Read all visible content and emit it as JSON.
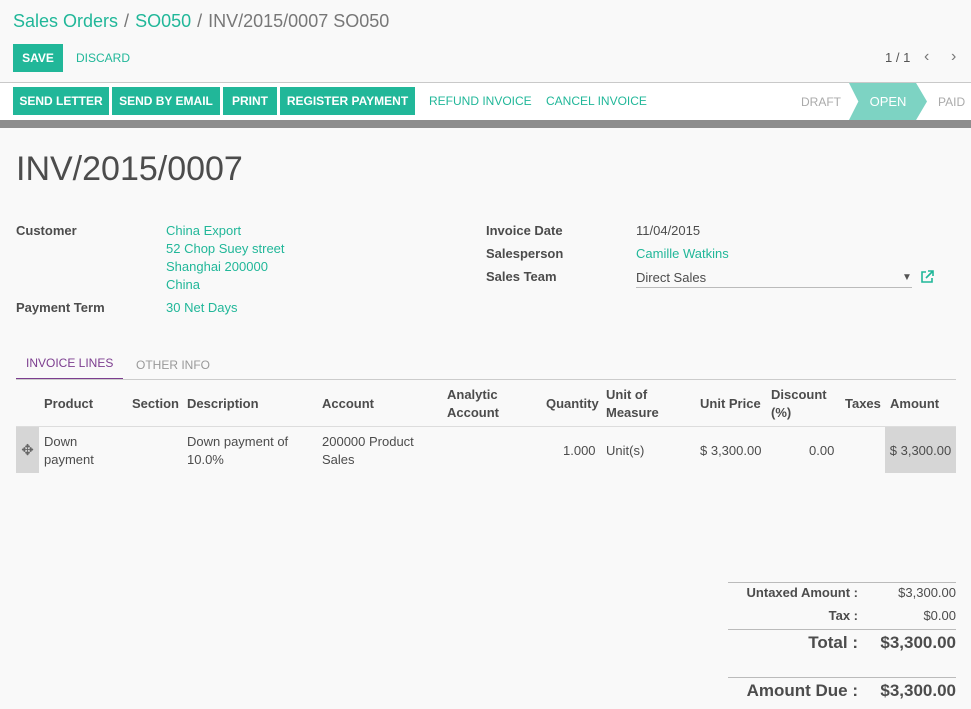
{
  "breadcrumb": {
    "root": "Sales Orders",
    "mid": "SO050",
    "current": "INV/2015/0007 SO050",
    "sep": "/"
  },
  "actions": {
    "save": "SAVE",
    "discard": "DISCARD"
  },
  "pager": {
    "value": "1 / 1",
    "prev": "‹",
    "next": "›"
  },
  "toolbar": {
    "send_letter": "SEND LETTER",
    "send_email": "SEND BY EMAIL",
    "print": "PRINT",
    "register_payment": "REGISTER PAYMENT",
    "refund": "REFUND INVOICE",
    "cancel": "CANCEL INVOICE"
  },
  "status": {
    "draft": "DRAFT",
    "open": "OPEN",
    "paid": "PAID",
    "active": "OPEN"
  },
  "invoice": {
    "title": "INV/2015/0007",
    "customer_label": "Customer",
    "customer_name": "China Export",
    "address1": "52 Chop Suey street",
    "address2": "Shanghai 200000",
    "address3": "China",
    "payment_term_label": "Payment Term",
    "payment_term": "30 Net Days",
    "date_label": "Invoice Date",
    "date": "11/04/2015",
    "salesperson_label": "Salesperson",
    "salesperson": "Camille Watkins",
    "team_label": "Sales Team",
    "team": "Direct Sales"
  },
  "tabs": {
    "lines": "INVOICE LINES",
    "other": "OTHER INFO"
  },
  "columns": {
    "product": "Product",
    "section": "Section",
    "description": "Description",
    "account": "Account",
    "analytic1": "Analytic",
    "analytic2": "Account",
    "quantity": "Quantity",
    "uom1": "Unit of",
    "uom2": "Measure",
    "unit_price": "Unit Price",
    "discount1": "Discount",
    "discount2": "(%)",
    "taxes": "Taxes",
    "amount": "Amount"
  },
  "line": {
    "product1": "Down",
    "product2": "payment",
    "description1": "Down payment of",
    "description2": "10.0%",
    "account1": "200000 Product",
    "account2": "Sales",
    "quantity": "1.000",
    "uom": "Unit(s)",
    "unit_price": "$ 3,300.00",
    "discount": "0.00",
    "amount": "$ 3,300.00"
  },
  "totals": {
    "untaxed_label": "Untaxed Amount :",
    "untaxed": "$3,300.00",
    "tax_label": "Tax :",
    "tax": "$0.00",
    "total_label": "Total :",
    "total": "$3,300.00",
    "due_label": "Amount Due :",
    "due": "$3,300.00"
  },
  "colors": {
    "accent": "#21b799",
    "tab_active": "#7c3d8f",
    "status_open": "#7dd3c3"
  }
}
